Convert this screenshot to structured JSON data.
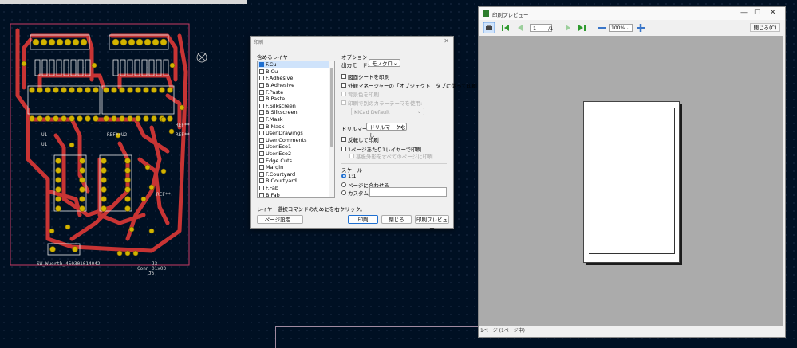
{
  "pcb": {
    "labels": [
      {
        "id": "u1a",
        "text": "U1"
      },
      {
        "id": "u1b",
        "text": "U1"
      },
      {
        "id": "ref_u2",
        "text": "REF**U2"
      },
      {
        "id": "ref1",
        "text": "REF**"
      },
      {
        "id": "ref2",
        "text": "REF**"
      },
      {
        "id": "ref3",
        "text": "REF**"
      },
      {
        "id": "sw",
        "text": "SW_Wuerth_450301014042"
      },
      {
        "id": "j3",
        "text": "J3"
      },
      {
        "id": "conn",
        "text": "Conn_01x03"
      },
      {
        "id": "j3b",
        "text": "J3"
      }
    ]
  },
  "print_dialog": {
    "title": "印刷",
    "layers_label": "含めるレイヤー",
    "layers": [
      {
        "name": "F.Cu",
        "checked": true,
        "selected": true
      },
      {
        "name": "B.Cu",
        "checked": false
      },
      {
        "name": "F.Adhesive",
        "checked": false
      },
      {
        "name": "B.Adhesive",
        "checked": false
      },
      {
        "name": "F.Paste",
        "checked": false
      },
      {
        "name": "B.Paste",
        "checked": false
      },
      {
        "name": "F.Silkscreen",
        "checked": false
      },
      {
        "name": "B.Silkscreen",
        "checked": false
      },
      {
        "name": "F.Mask",
        "checked": false
      },
      {
        "name": "B.Mask",
        "checked": false
      },
      {
        "name": "User.Drawings",
        "checked": false
      },
      {
        "name": "User.Comments",
        "checked": false
      },
      {
        "name": "User.Eco1",
        "checked": false
      },
      {
        "name": "User.Eco2",
        "checked": false
      },
      {
        "name": "Edge.Cuts",
        "checked": false
      },
      {
        "name": "Margin",
        "checked": false
      },
      {
        "name": "F.Courtyard",
        "checked": false
      },
      {
        "name": "B.Courtyard",
        "checked": false
      },
      {
        "name": "F.Fab",
        "checked": false
      },
      {
        "name": "B.Fab",
        "checked": false
      }
    ],
    "hint": "レイヤー選択コマンドのためにを右クリック。",
    "options_label": "オプション",
    "output_mode_label": "出力モード:",
    "output_mode_value": "モノクロ",
    "draw_sheet": "図面シートを印刷",
    "external_manager": "外観マネージャーの「オブジェクト」タブに従って印刷",
    "background_color": "背景色を印刷",
    "other_color_theme": "印刷で別のカラーテーマを使用:",
    "theme_value": "KiCad Default",
    "drill_label": "ドリルマーク:",
    "drill_value": "ドリルマークなし",
    "mirror": "反転して印刷",
    "one_page_per_layer": "1ページあたり1レイヤーで印刷",
    "edge_on_all": "基板外形をすべてのページに印刷",
    "scale_label": "スケール",
    "scale_1to1": "1:1",
    "scale_fit": "ページに合わせる",
    "scale_custom": "カスタム:",
    "page_setup": "ページ設定...",
    "print": "印刷",
    "close": "閉じる",
    "preview": "印刷プレビュー"
  },
  "preview_window": {
    "title": "印刷プレビュー",
    "minimize": "—",
    "maximize": "☐",
    "close_x": "✕",
    "page_current": "1",
    "page_total": "/1",
    "zoom": "100%",
    "close_button": "閉じる(C)",
    "status": "1ページ (1ページ中)"
  },
  "colors": {
    "canvas_bg": "#001023",
    "copper": "#c83434",
    "pad": "#d2b400",
    "silk": "#e8e8e8",
    "edge": "#c83c64",
    "preview_bg": "#ababab",
    "accent": "#1f6fd0"
  },
  "icons": [
    "printer-icon",
    "first-page-icon",
    "prev-page-icon",
    "next-page-icon",
    "last-page-icon",
    "zoom-out-icon",
    "zoom-in-icon",
    "app-icon",
    "crosshair-icon"
  ]
}
